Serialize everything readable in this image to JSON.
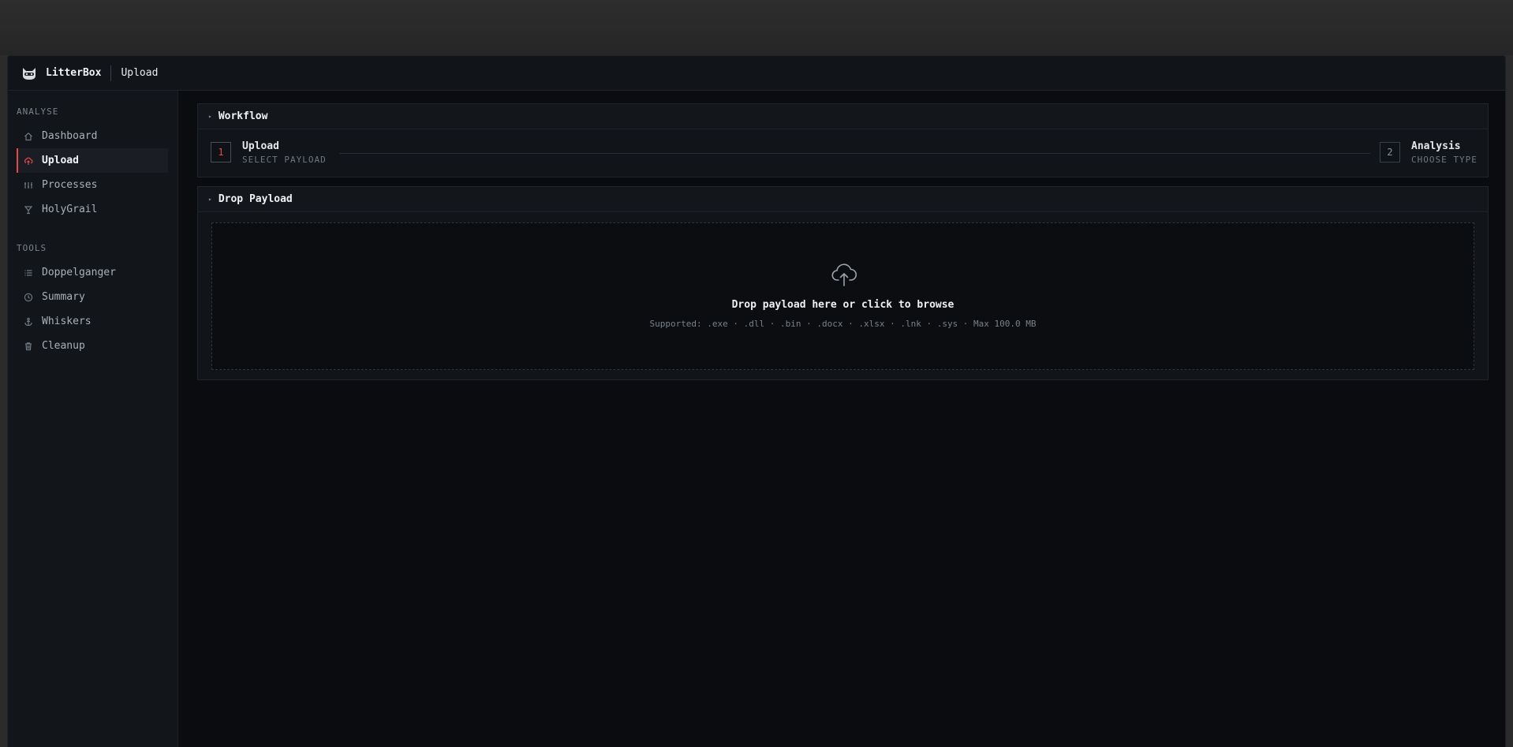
{
  "app": {
    "name": "LitterBox",
    "page": "Upload"
  },
  "sidebar": {
    "sections": [
      {
        "label": "ANALYSE",
        "items": [
          {
            "label": "Dashboard",
            "icon": "home-icon"
          },
          {
            "label": "Upload",
            "icon": "upload-cloud-icon",
            "active": true
          },
          {
            "label": "Processes",
            "icon": "sliders-icon"
          },
          {
            "label": "HolyGrail",
            "icon": "grail-icon"
          }
        ]
      },
      {
        "label": "TOOLS",
        "items": [
          {
            "label": "Doppelganger",
            "icon": "list-icon"
          },
          {
            "label": "Summary",
            "icon": "clock-icon"
          },
          {
            "label": "Whiskers",
            "icon": "anchor-icon"
          },
          {
            "label": "Cleanup",
            "icon": "trash-icon"
          }
        ]
      }
    ]
  },
  "workflow": {
    "title": "Workflow",
    "steps": [
      {
        "number": "1",
        "title": "Upload",
        "subtitle": "SELECT PAYLOAD",
        "current": true
      },
      {
        "number": "2",
        "title": "Analysis",
        "subtitle": "CHOOSE TYPE",
        "current": false
      }
    ]
  },
  "drop": {
    "title": "Drop Payload",
    "prompt": "Drop payload here or click to browse",
    "supported": "Supported: .exe · .dll · .bin · .docx · .xlsx · .lnk · .sys · Max 100.0 MB",
    "icon": "upload-cloud-icon"
  },
  "colors": {
    "accent": "#e5484d",
    "background": "#0a0c0f",
    "panel": "#111418"
  }
}
